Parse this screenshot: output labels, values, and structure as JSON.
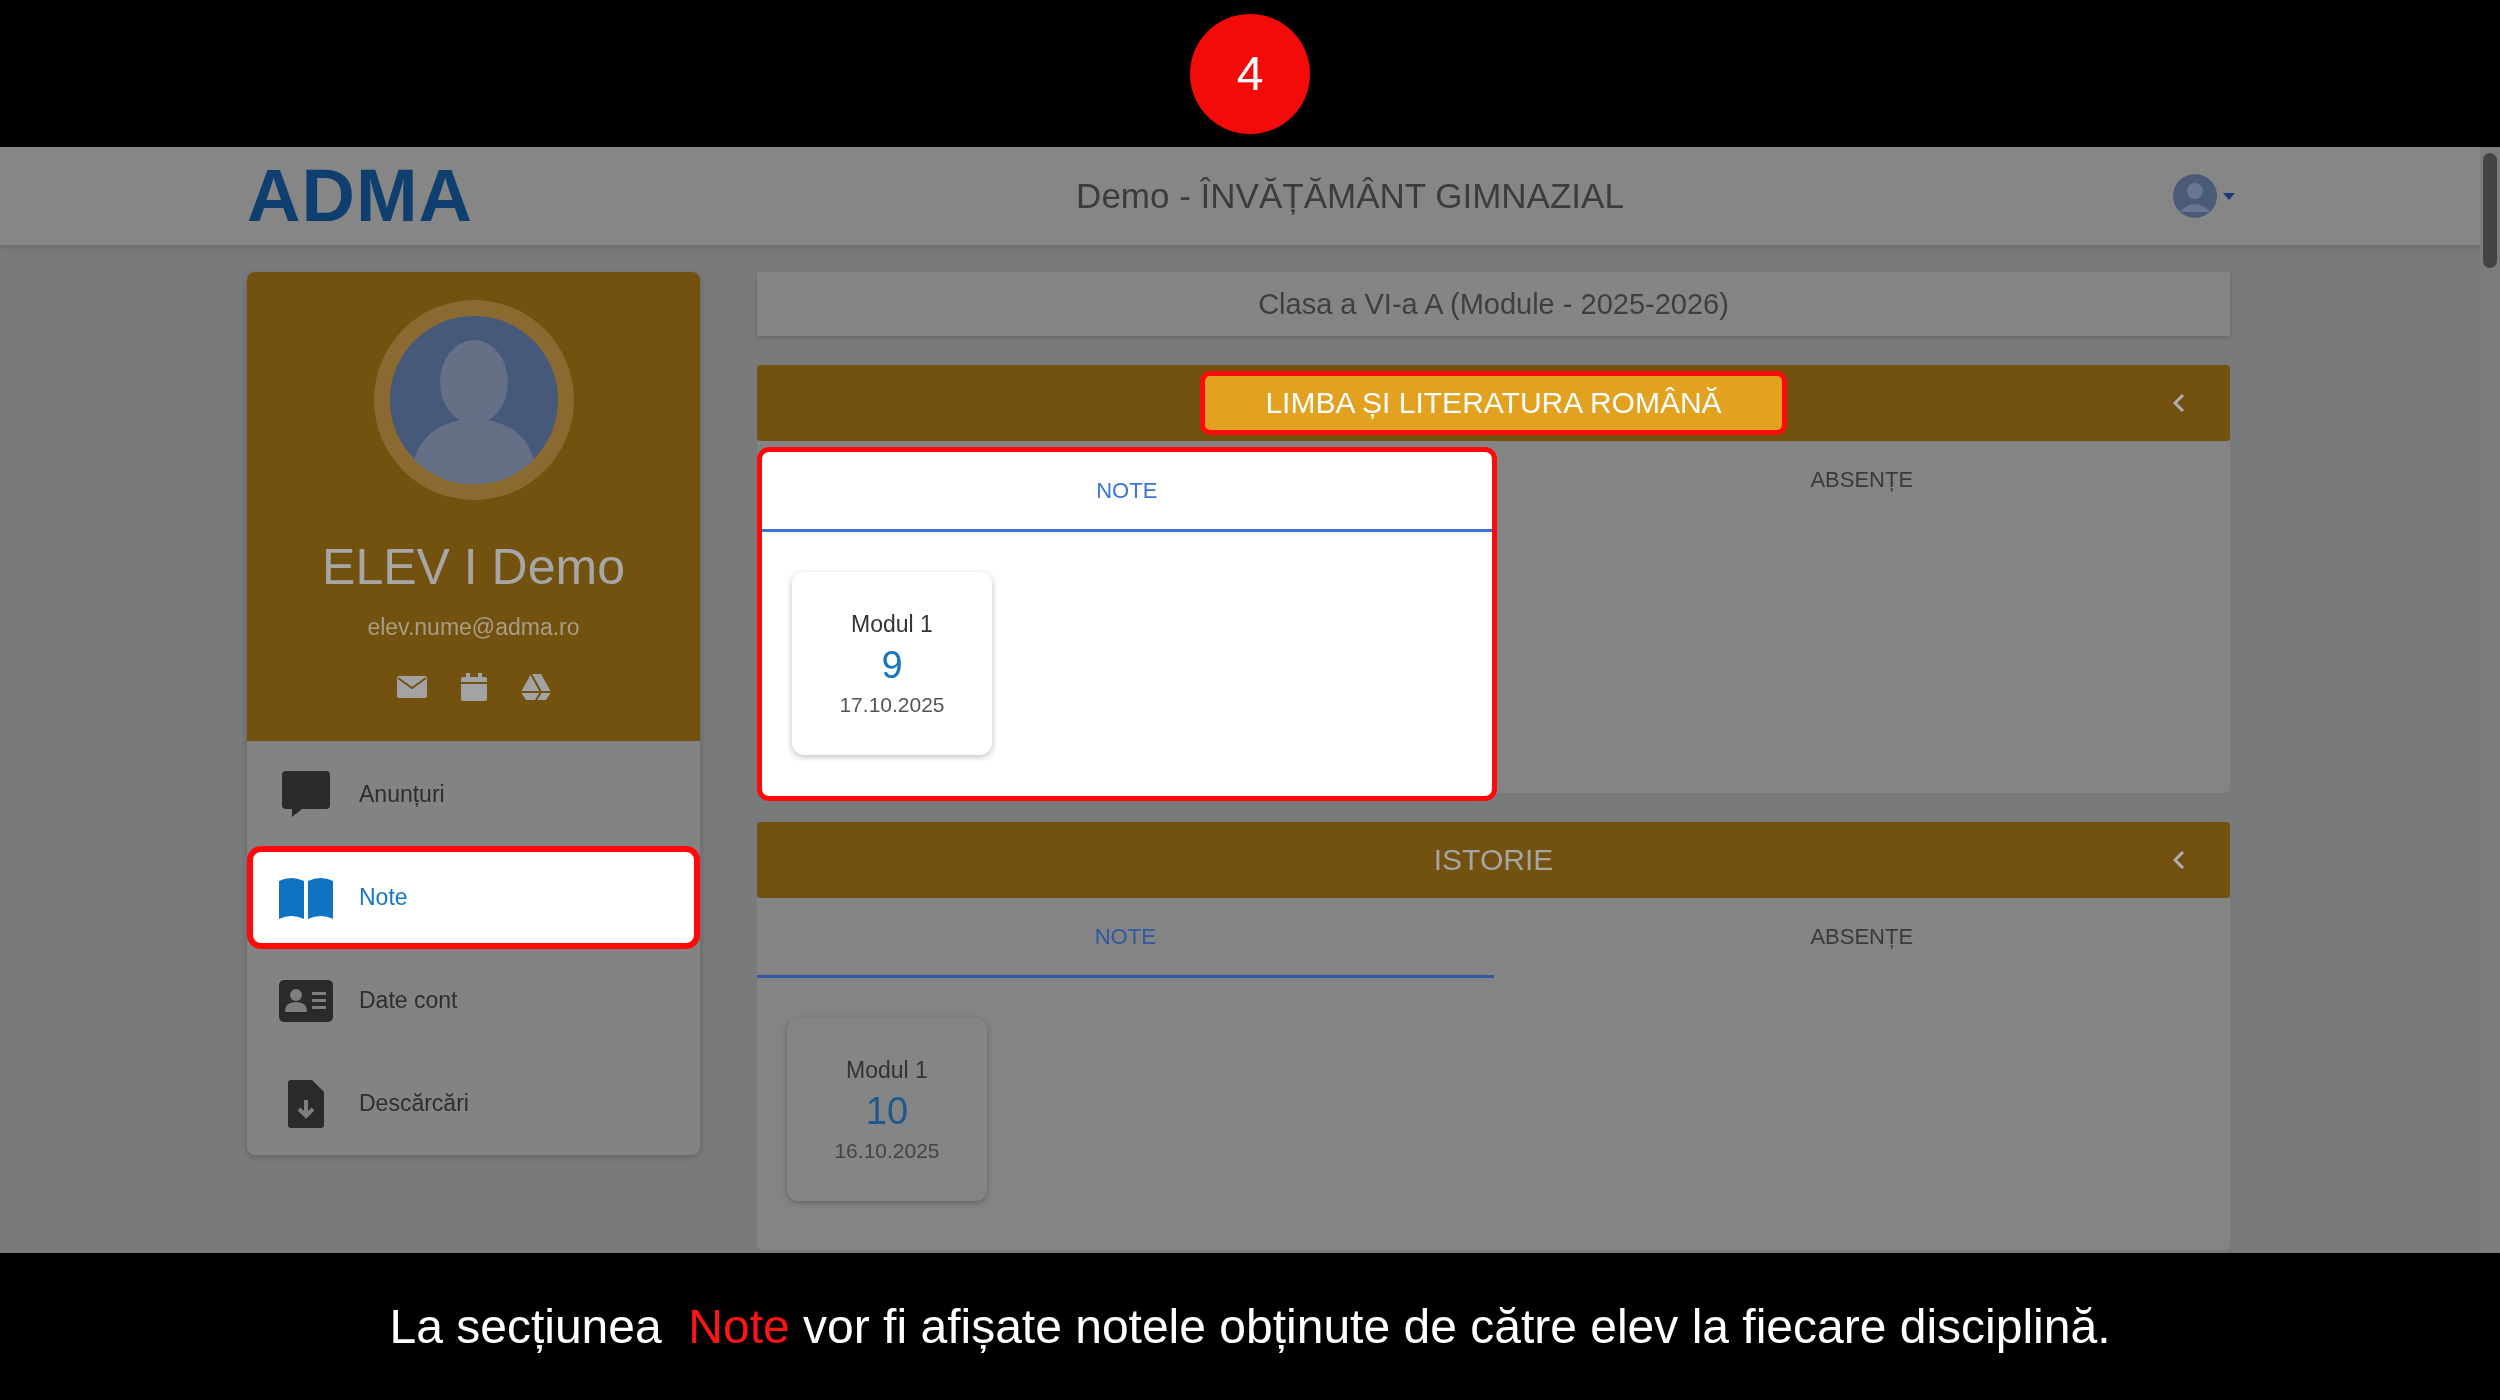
{
  "step": {
    "number": "4"
  },
  "header": {
    "logo": "ADMA",
    "title": "Demo - ÎNVĂȚĂMÂNT GIMNAZIAL"
  },
  "profile": {
    "name": "ELEV I Demo",
    "email": "elev.nume@adma.ro"
  },
  "nav": [
    {
      "label": "Anunțuri",
      "kind": "chat",
      "selected": false,
      "highlighted": false
    },
    {
      "label": "Note",
      "kind": "book",
      "selected": true,
      "highlighted": true
    },
    {
      "label": "Date cont",
      "kind": "card",
      "selected": false,
      "highlighted": false
    },
    {
      "label": "Descărcări",
      "kind": "download",
      "selected": false,
      "highlighted": false
    }
  ],
  "class_bar": "Clasa a VI-a A (Module - 2025-2026)",
  "subjects": [
    {
      "title": "LIMBA ȘI LITERATURA ROMÂNĂ",
      "highlighted": true,
      "tabs": [
        {
          "label": "NOTE",
          "selected": true
        },
        {
          "label": "ABSENȚE",
          "selected": false
        }
      ],
      "grades": [
        {
          "module": "Modul 1",
          "grade": "9",
          "date": "17.10.2025"
        }
      ]
    },
    {
      "title": "ISTORIE",
      "highlighted": false,
      "tabs": [
        {
          "label": "NOTE",
          "selected": true
        },
        {
          "label": "ABSENȚE",
          "selected": false
        }
      ],
      "grades": [
        {
          "module": "Modul 1",
          "grade": "10",
          "date": "16.10.2025"
        }
      ]
    }
  ],
  "caption": {
    "before": "La secțiunea",
    "highlight": "Note",
    "after": "vor fi afișate notele obținute de către elev la fiecare disciplină."
  }
}
